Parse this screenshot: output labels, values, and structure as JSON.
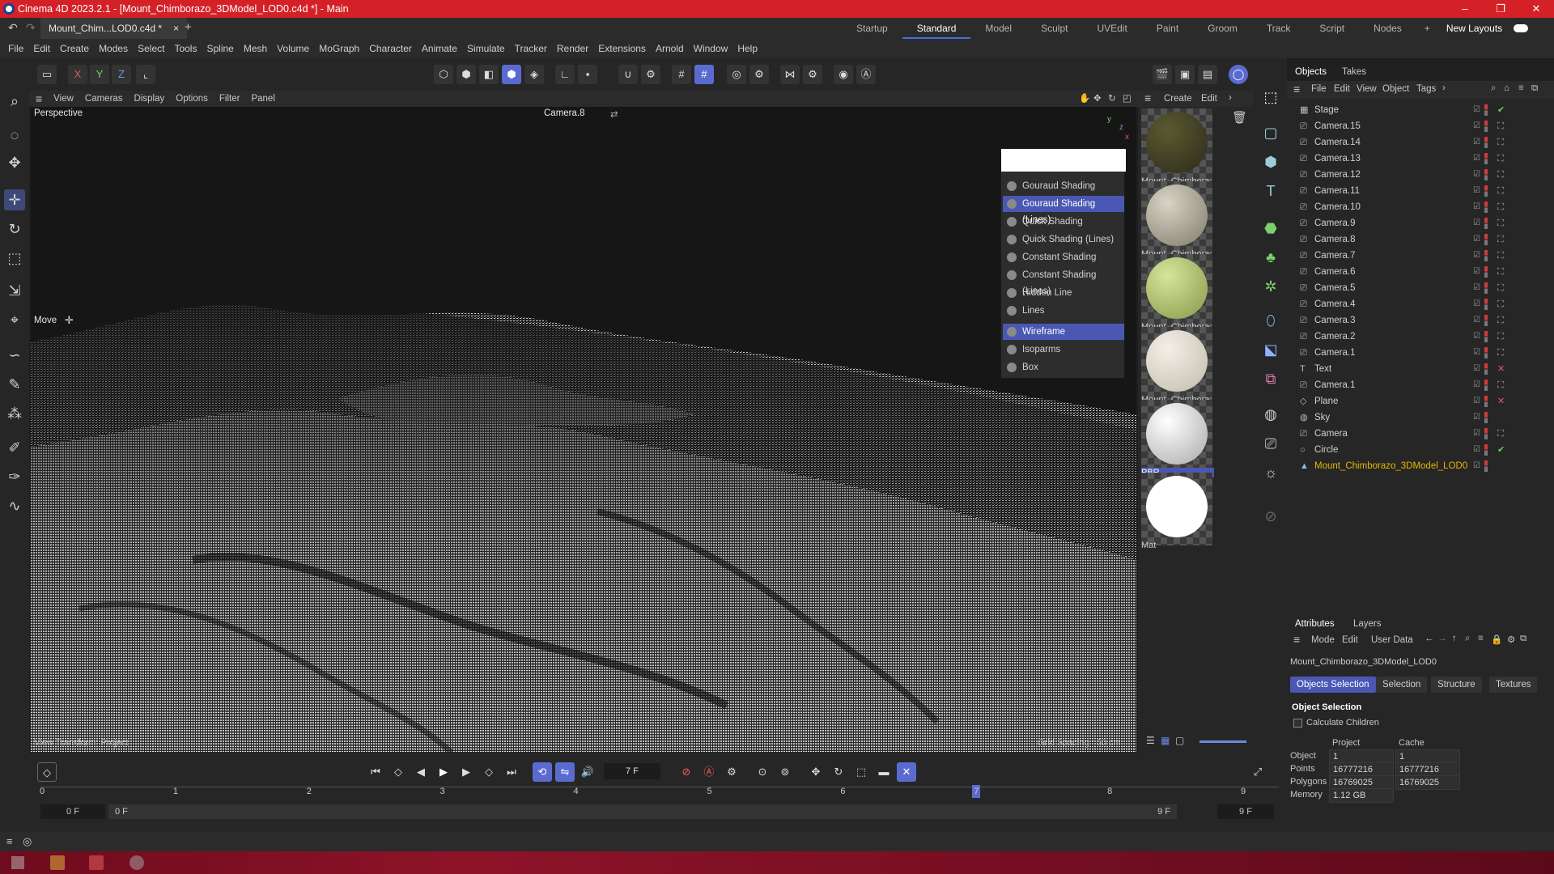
{
  "window": {
    "title": "Cinema 4D 2023.2.1 - [Mount_Chimborazo_3DModel_LOD0.c4d *] - Main"
  },
  "tabs": {
    "document": "Mount_Chim...LOD0.c4d *",
    "close": "×",
    "add": "+"
  },
  "layouts": {
    "items": [
      "Startup",
      "Standard",
      "Model",
      "Sculpt",
      "UVEdit",
      "Paint",
      "Groom",
      "Track",
      "Script",
      "Nodes"
    ],
    "add": "+",
    "new_layouts": "New Layouts"
  },
  "menu": {
    "items": [
      "File",
      "Edit",
      "Create",
      "Modes",
      "Select",
      "Tools",
      "Spline",
      "Mesh",
      "Volume",
      "MoGraph",
      "Character",
      "Animate",
      "Simulate",
      "Tracker",
      "Render",
      "Extensions",
      "Arnold",
      "Window",
      "Help"
    ]
  },
  "toolbar": {
    "x": "X",
    "y": "Y",
    "z": "Z"
  },
  "viewport": {
    "menu": [
      "View",
      "Cameras",
      "Display",
      "Options",
      "Filter",
      "Panel"
    ],
    "name": "Perspective",
    "camera": "Camera.8",
    "tool": "Move",
    "footer_left": "View Transform: Project",
    "footer_right": "Grid Spacing : 50 cm",
    "axis": {
      "y": "y",
      "z": "z",
      "x": "x"
    }
  },
  "shading_menu": {
    "items": [
      "Gouraud Shading",
      "Gouraud Shading (Lines)",
      "Quick Shading",
      "Quick Shading (Lines)",
      "Constant Shading",
      "Constant Shading (Lines)",
      "Hidden Line",
      "Lines",
      "Wireframe",
      "Isoparms",
      "Box"
    ],
    "highlighted": [
      "Gouraud Shading (Lines)",
      "Wireframe"
    ]
  },
  "materials": {
    "menu": [
      "Create",
      "Edit"
    ],
    "items": [
      {
        "label": "Mount_Chimbora:",
        "color_a": "#5a5a30",
        "color_b": "#2c2a1c"
      },
      {
        "label": "Mount_Chimbora:",
        "color_a": "#d8d4c6",
        "color_b": "#807b6a"
      },
      {
        "label": "Mount_Chimbora:",
        "color_a": "#d6e59a",
        "color_b": "#86984a"
      },
      {
        "label": "Mount_Chimbora:",
        "color_a": "#f3efe6",
        "color_b": "#c2bcac"
      },
      {
        "label": "PBR",
        "color_a": "#ffffff",
        "color_b": "#a9a9a9"
      },
      {
        "label": "Mat",
        "color_a": "#ffffff",
        "color_b": "#ffffff"
      }
    ]
  },
  "objects": {
    "tabs": [
      "Objects",
      "Takes"
    ],
    "menu": [
      "File",
      "Edit",
      "View",
      "Object",
      "Tags"
    ],
    "items": [
      "Stage",
      "Camera.15",
      "Camera.14",
      "Camera.13",
      "Camera.12",
      "Camera.11",
      "Camera.10",
      "Camera.9",
      "Camera.8",
      "Camera.7",
      "Camera.6",
      "Camera.5",
      "Camera.4",
      "Camera.3",
      "Camera.2",
      "Camera.1",
      "Text",
      "Camera.1",
      "Plane",
      "Sky",
      "Camera",
      "Circle",
      "Mount_Chimborazo_3DModel_LOD0"
    ],
    "selected_color": "#e6b800"
  },
  "attributes": {
    "tabs": [
      "Attributes",
      "Layers"
    ],
    "menu": [
      "Mode",
      "Edit",
      "User Data"
    ],
    "object_name": "Mount_Chimborazo_3DModel_LOD0",
    "buttons": [
      "Objects Selection",
      "Selection",
      "Structure",
      "Textures"
    ],
    "section": "Object Selection",
    "checkbox": "Calculate Children",
    "col_project": "Project",
    "col_cache": "Cache",
    "rows": [
      {
        "label": "Object",
        "project": "1",
        "cache": "1"
      },
      {
        "label": "Points",
        "project": "16777216",
        "cache": "16777216"
      },
      {
        "label": "Polygons",
        "project": "16769025",
        "cache": "16769025"
      },
      {
        "label": "Memory",
        "project": "1.12 GB",
        "cache": ""
      }
    ]
  },
  "timeline": {
    "current_frame": "7 F",
    "start_frame": "0 F",
    "range_start": "0 F",
    "range_end": "9 F",
    "end_frame": "9 F",
    "ticks": [
      "0",
      "1",
      "2",
      "3",
      "4",
      "5",
      "6",
      "7",
      "8",
      "9"
    ],
    "playhead_frame": 7
  }
}
